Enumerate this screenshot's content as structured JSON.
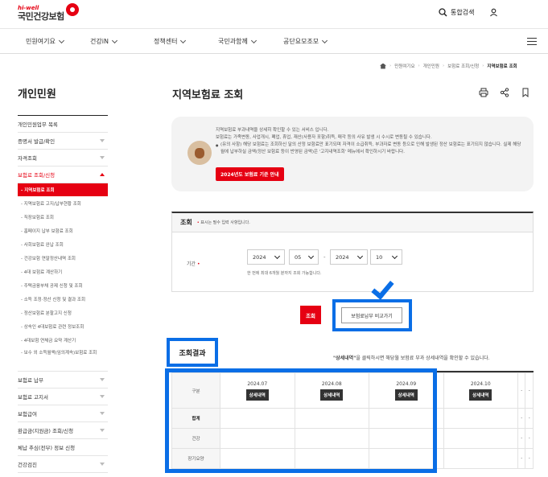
{
  "logo": {
    "top": "hi-well",
    "main": "국민건강보험"
  },
  "header": {
    "search_label": "통합검색"
  },
  "gnb": [
    {
      "label": "민원여기요"
    },
    {
      "label": "건강iN"
    },
    {
      "label": "정책센터"
    },
    {
      "label": "국민과함께"
    },
    {
      "label": "공단요모조모"
    }
  ],
  "breadcrumb": [
    "민원여기요",
    "개인민원",
    "보험료 조회/신청",
    "지역보험료 조회"
  ],
  "lnb": {
    "title": "개인민원",
    "items_top": [
      {
        "label": "개인민원업무 목록"
      },
      {
        "label": "증명서 발급/확인"
      },
      {
        "label": "자격조회"
      },
      {
        "label": "보험료 조회/신청"
      }
    ],
    "sub_items": [
      {
        "label": "- 지역보험료 조회"
      },
      {
        "label": "- 지역보험료 고지/납부현황 조회"
      },
      {
        "label": "- 직장보험료 조회"
      },
      {
        "label": "- 홈페이지 납부 보험료 조회"
      },
      {
        "label": "- 사회보험료 완납 조회"
      },
      {
        "label": "- 건강보험 연말정산내역 조회"
      },
      {
        "label": "- 4대 보험료 계산하기"
      },
      {
        "label": "- 주택금융부채 공제 신청 및 조회"
      },
      {
        "label": "- 소득 조정·정산 신청 및 결과 조회"
      },
      {
        "label": "- 정산보험료 분할고지 신청"
      },
      {
        "label": "- 상속인 4대보험료 관련 정보조회"
      },
      {
        "label": "- 4대보험 연체금 요약 계산기"
      },
      {
        "label": "- 보수 외 소득월액(임의계속)보험료 조회"
      }
    ],
    "items_bottom": [
      {
        "label": "보험료 납부"
      },
      {
        "label": "보험료 고지서"
      },
      {
        "label": "보험급여"
      },
      {
        "label": "환급금(지원금) 조회/신청"
      },
      {
        "label": "체납 추심(전부) 정보 신청"
      },
      {
        "label": "건강검진"
      }
    ]
  },
  "page": {
    "title": "지역보험료 조회"
  },
  "info": {
    "line1": "지역보험료 부과내역을 상세히 확인할 수 있는 서비스 입니다.",
    "line2": "보험료는 가족변동, 사업개시, 폐업, 휴업, 재산(사용자 포함)취득, 매각 등의 사유 발생 시 수시로 변동될 수 있습니다.",
    "line3": "(유의 사항) 해당 보험료는 조회하신 달의 산정 보험료만 표기되며 자격이 소급취득, 부과자료 변동 등으로 인해 발생된 정산 보험료는 표기되지 않습니다. 실제 해당 월에 납부하실 금액(정산 보험료 등이 반영된 금액)은 '고지내역조회' 메뉴에서 확인하시기 바랍니다.",
    "notice_button": "2024년도 보험료 기준 안내"
  },
  "search": {
    "title": "조회",
    "required_note": "표시는 필수 입력 사항입니다.",
    "period_label": "기간",
    "from_year": "2024",
    "from_month": "05",
    "to_year": "2024",
    "to_month": "10",
    "help": "한 번에 최대 6개월 분까지 조회 가능합니다.",
    "search_button": "조회",
    "compare_button": "보험료납부 비교가기"
  },
  "result": {
    "title": "조회결과",
    "note_quote": "\"상세내역\"",
    "note_rest": "을 클릭하시면 해당월 보험료 부과 상세내역을 확인할 수 있습니다.",
    "col_header": "구분",
    "detail_label": "상세내역",
    "months": [
      "2024.07",
      "2024.08",
      "2024.09",
      "2024.10"
    ],
    "extra_cols": [
      "-",
      "-"
    ],
    "rows": [
      {
        "label": "합계",
        "values": [
          "",
          "",
          "",
          "",
          "-",
          "-"
        ]
      },
      {
        "label": "건강",
        "values": [
          "",
          "",
          "",
          "",
          "-",
          "-"
        ]
      },
      {
        "label": "장기요양",
        "values": [
          "",
          "",
          "",
          "",
          "-",
          "-"
        ]
      }
    ]
  }
}
